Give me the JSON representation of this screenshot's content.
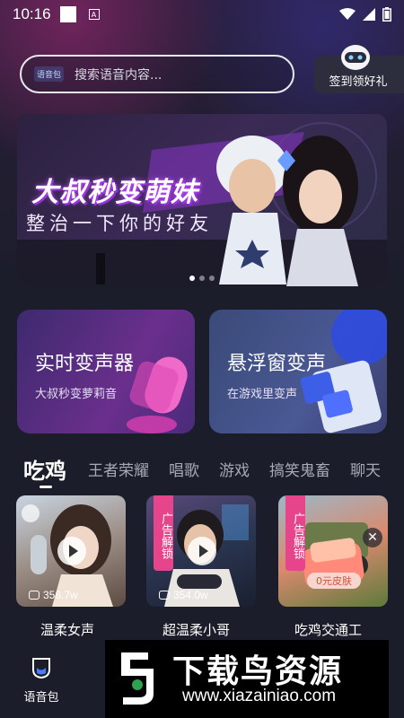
{
  "status_bar": {
    "time": "10:16",
    "text_icon": "A"
  },
  "search": {
    "tag": "语音包",
    "placeholder": "搜索语音内容..."
  },
  "checkin": {
    "label": "签到领好礼"
  },
  "banner": {
    "title": "大叔秒变萌妹",
    "subtitle": "整治一下你的好友",
    "active_slide": 0,
    "slide_count": 3
  },
  "feature_cards": [
    {
      "title": "实时变声器",
      "subtitle": "大叔秒变萝莉音"
    },
    {
      "title": "悬浮窗变声",
      "subtitle": "在游戏里变声"
    }
  ],
  "tabs": [
    "吃鸡",
    "王者荣耀",
    "唱歌",
    "游戏",
    "搞笑鬼畜",
    "聊天"
  ],
  "active_tab": "吃鸡",
  "voice_items": [
    {
      "title": "温柔女声",
      "plays": "356.7w",
      "ad": false
    },
    {
      "title": "超温柔小哥",
      "plays": "354.0w",
      "ad": true,
      "ad_label": "广告解锁"
    },
    {
      "title": "吃鸡交通工",
      "plays": "",
      "ad": true,
      "ad_label": "广告解锁",
      "chip": "0元皮肤"
    }
  ],
  "bottom_nav": {
    "voice_pack": "语音包"
  },
  "watermark": {
    "title": "下载鸟资源",
    "url": "www.xiazainiao.com"
  },
  "colors": {
    "accent_pink": "#e6448b",
    "background": "#1b1d2a"
  }
}
